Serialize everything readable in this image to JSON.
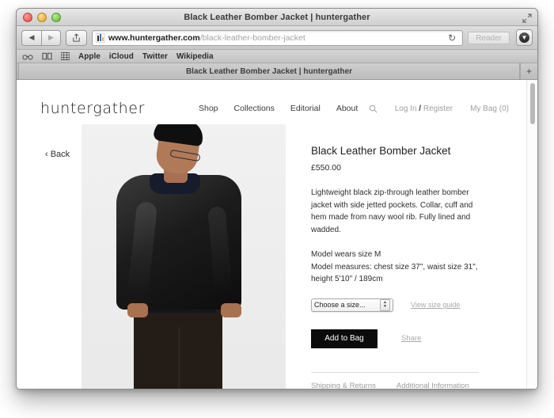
{
  "window": {
    "title": "Black Leather Bomber Jacket | huntergather",
    "traffic_lights": [
      "close",
      "minimize",
      "zoom"
    ],
    "fullscreen_icon": "fullscreen-icon"
  },
  "toolbar": {
    "back_icon": "back-arrow-icon",
    "forward_icon": "forward-arrow-icon",
    "share_icon": "share-icon",
    "url_host": "www.huntergather.com",
    "url_path": "/black-leather-bomber-jacket",
    "reload_icon": "reload-icon",
    "reader_label": "Reader",
    "downloads_icon": "downloads-icon"
  },
  "bookmarks_bar": {
    "icons": [
      "reading-list-icon",
      "bookmarks-icon",
      "top-sites-icon"
    ],
    "items": [
      {
        "label": "Apple"
      },
      {
        "label": "iCloud"
      },
      {
        "label": "Twitter"
      },
      {
        "label": "Wikipedia"
      }
    ]
  },
  "tabbar": {
    "tab_title": "Black Leather Bomber Jacket | huntergather",
    "new_tab_label": "+"
  },
  "site": {
    "logo": "huntergather",
    "nav": [
      {
        "label": "Shop"
      },
      {
        "label": "Collections"
      },
      {
        "label": "Editorial"
      },
      {
        "label": "About"
      }
    ],
    "search_icon": "search-icon",
    "login_prefix": "Log In ",
    "login_separator": "/",
    "login_suffix": " Register",
    "bag_label": "My Bag (0)"
  },
  "product": {
    "back_label": "‹ Back",
    "image_alt": "Model wearing black leather bomber jacket",
    "title": "Black Leather Bomber Jacket",
    "price": "£550.00",
    "description": "Lightweight black zip-through leather bomber jacket with side jetted pockets. Collar, cuff and hem made from navy wool rib. Fully lined and wadded.",
    "measurements": "Model wears size M\nModel measures: chest size 37\", waist size 31\", height 5'10\" / 189cm",
    "size_placeholder": "Choose a size...",
    "size_guide_label": "View size guide",
    "add_to_bag_label": "Add to Bag",
    "share_label": "Share",
    "info_links": [
      {
        "label": "Shipping & Returns"
      },
      {
        "label": "Additional Information"
      }
    ]
  }
}
